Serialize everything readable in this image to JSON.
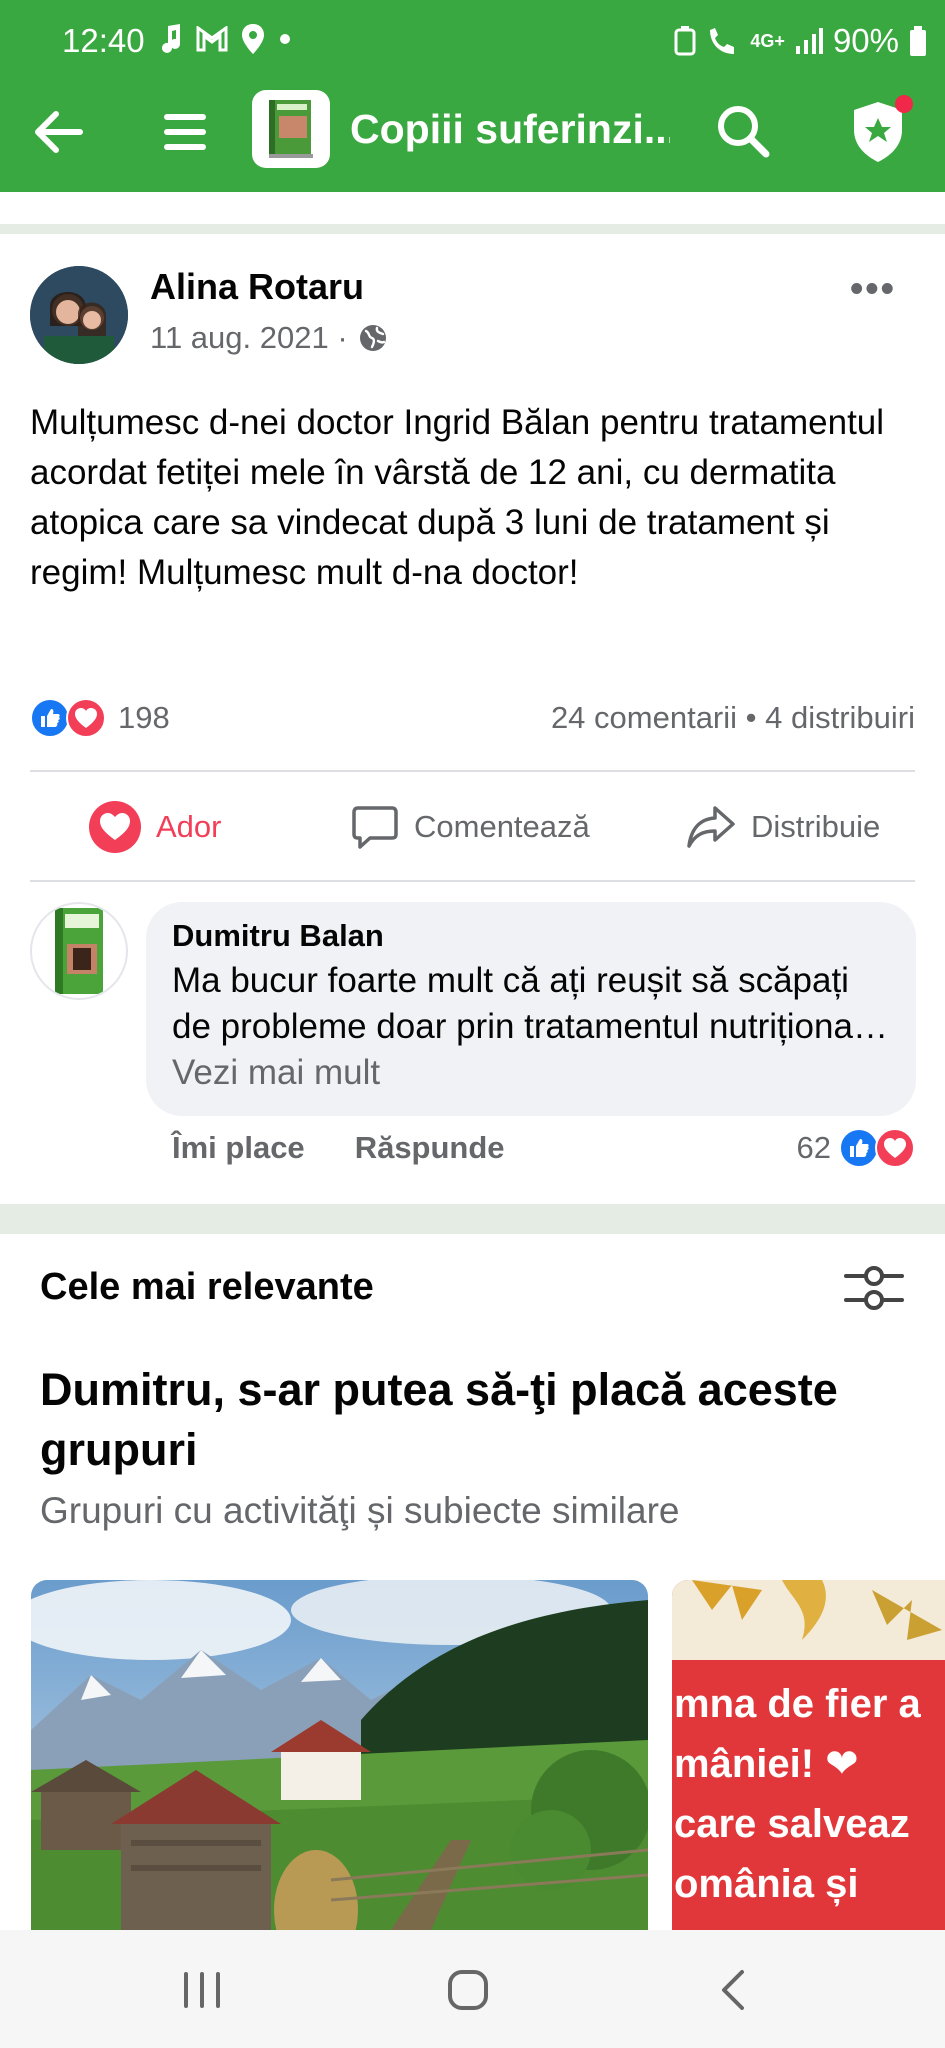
{
  "status_bar": {
    "time": "12:40",
    "battery": "90%",
    "network": "4G+"
  },
  "toolbar": {
    "title": "Copiii suferinzi..."
  },
  "post": {
    "author": "Alina Rotaru",
    "date": "11 aug. 2021 ·",
    "text": "Mulțumesc d-nei doctor Ingrid Bălan pentru tratamentul acordat fetiței mele în vârstă de 12 ani, cu dermatita atopica care sa vindecat după 3 luni de tratament și regim! Mulțumesc mult d-na doctor!",
    "reaction_count": "198",
    "comments_shares": "24 comentarii • 4 distribuiri",
    "actions": {
      "love": "Ador",
      "comment": "Comentează",
      "share": "Distribuie"
    }
  },
  "comment": {
    "author": "Dumitru Balan",
    "text": "Ma bucur foarte mult că ați reușit să scăpați de probleme doar prin tratamentul nutriționa…",
    "see_more": "Vezi mai mult",
    "like": "Îmi place",
    "reply": "Răspunde",
    "reaction_count": "62"
  },
  "suggestions": {
    "sort_label": "Cele mai relevante",
    "title": "Dumitru, s-ar putea să-ţi placă aceste grupuri",
    "subtitle": "Grupuri cu activităţi și subiecte similare",
    "card2_lines": [
      "mna de fier a",
      "mâniei! ❤",
      "care salveaz",
      "omânia și"
    ]
  },
  "colors": {
    "header_green": "#3aa840",
    "love_red": "#f33e58",
    "like_blue": "#1877f2"
  }
}
